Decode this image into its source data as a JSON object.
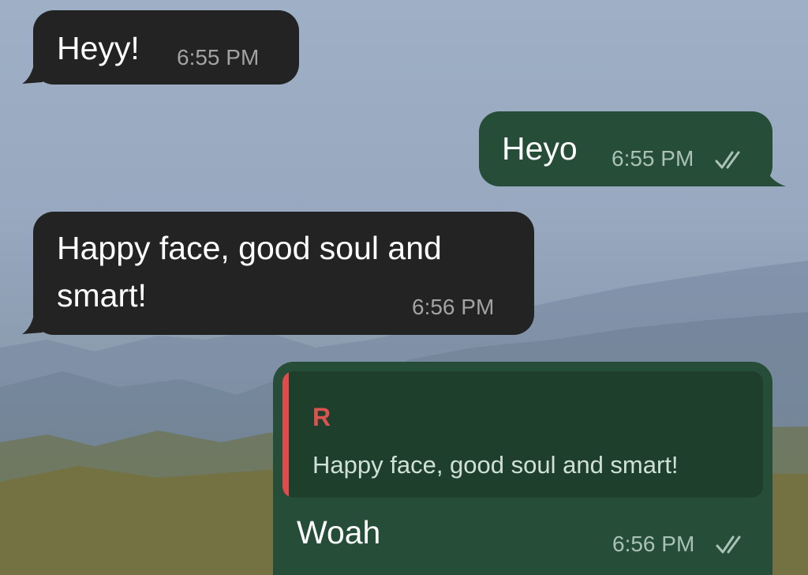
{
  "messages": [
    {
      "direction": "incoming",
      "text": "Heyy!",
      "time": "6:55 PM"
    },
    {
      "direction": "outgoing",
      "text": "Heyo",
      "time": "6:55 PM",
      "status_icon": "double-check-icon"
    },
    {
      "direction": "incoming",
      "text_lines": [
        "Happy face, good soul and",
        "smart!"
      ],
      "time": "6:56 PM"
    },
    {
      "direction": "outgoing",
      "reply_to": {
        "author": "R",
        "text": "Happy face, good soul and smart!"
      },
      "text": "Woah",
      "time": "6:56 PM",
      "status_icon": "double-check-icon"
    }
  ],
  "colors": {
    "incoming_bubble": "#232323",
    "outgoing_bubble": "#264d38",
    "quote_background": "#1e3f2c",
    "quote_accent": "#e04b4b",
    "quote_author": "#d9534f"
  }
}
